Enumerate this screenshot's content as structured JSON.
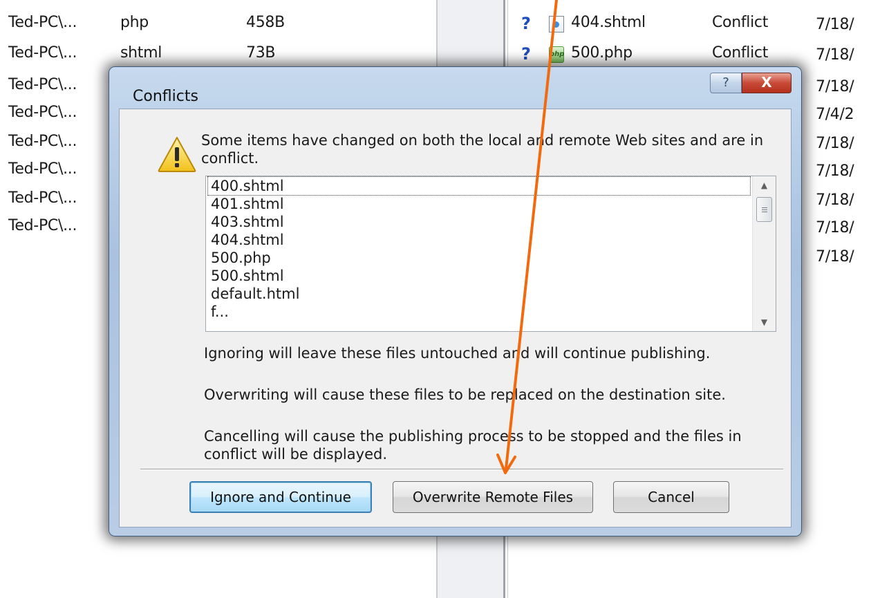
{
  "local_rows": [
    {
      "path": "Ted-PC\\...",
      "type": "php",
      "size": "458B"
    },
    {
      "path": "Ted-PC\\...",
      "type": "shtml",
      "size": "73B"
    },
    {
      "path": "Ted-PC\\...",
      "type": "",
      "size": ""
    },
    {
      "path": "Ted-PC\\...",
      "type": "",
      "size": ""
    },
    {
      "path": "Ted-PC\\...",
      "type": "",
      "size": ""
    },
    {
      "path": "Ted-PC\\...",
      "type": "",
      "size": ""
    },
    {
      "path": "Ted-PC\\...",
      "type": "",
      "size": ""
    },
    {
      "path": "Ted-PC\\...",
      "type": "",
      "size": ""
    }
  ],
  "remote_rows": [
    {
      "name": "404.shtml",
      "status": "Conflict",
      "icon": "html-file-icon"
    },
    {
      "name": "500.php",
      "status": "Conflict",
      "icon": "php-file-icon"
    }
  ],
  "remote_dates": [
    "7/18/",
    "7/18/",
    "7/18/",
    "7/4/2",
    "7/18/",
    "7/18/",
    "7/18/",
    "7/18/",
    "7/18/"
  ],
  "dialog": {
    "title": "Conflicts",
    "help_glyph": "?",
    "close_glyph": "X",
    "message": "Some items have changed on both the local and remote Web sites and are in conflict.",
    "files": [
      "400.shtml",
      "401.shtml",
      "403.shtml",
      "404.shtml",
      "500.php",
      "500.shtml",
      "default.html",
      "f..."
    ],
    "ignore_text": "Ignoring will leave these files untouched and will continue publishing.",
    "overwrite_text": "Overwriting will cause these files to be replaced on the destination site.",
    "cancel_text": "Cancelling will cause the publishing process to be stopped and the files in conflict will be displayed.",
    "buttons": {
      "ignore": "Ignore and Continue",
      "overwrite": "Overwrite Remote Files",
      "cancel": "Cancel"
    }
  },
  "colors": {
    "annotation_arrow": "#f26a0f",
    "question_mark": "#1f4fb8"
  }
}
